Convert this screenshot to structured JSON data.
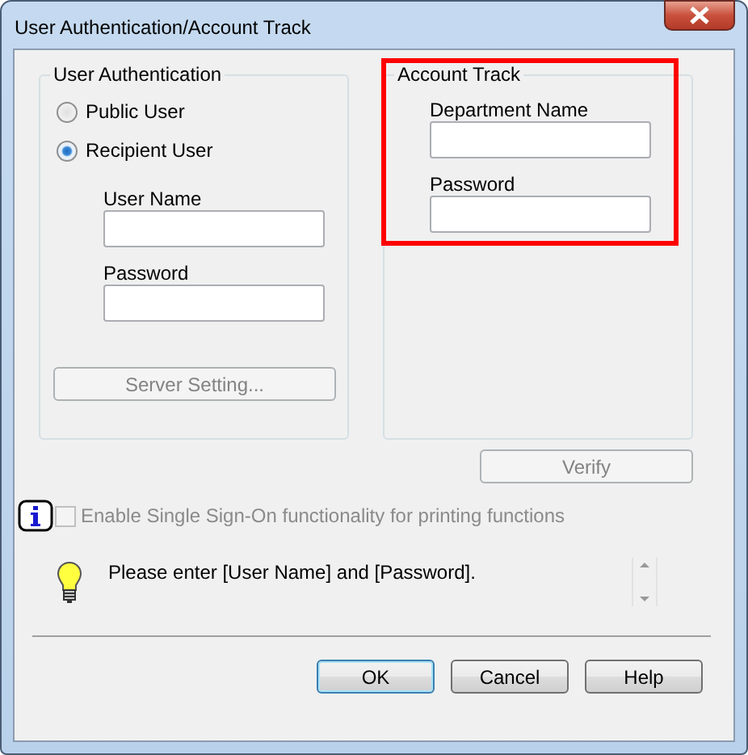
{
  "window": {
    "title": "User Authentication/Account Track"
  },
  "user_authentication": {
    "title": "User Authentication",
    "options": [
      {
        "label": "Public User",
        "selected": false
      },
      {
        "label": "Recipient User",
        "selected": true
      }
    ],
    "fields": [
      {
        "label": "User Name"
      },
      {
        "label": "Password"
      }
    ],
    "server_button": {
      "label": "Server Setting...",
      "disabled": true
    }
  },
  "account_track": {
    "title": "Account Track",
    "highlighted": true,
    "fields": [
      {
        "label": "Department Name"
      },
      {
        "label": "Password"
      }
    ]
  },
  "verify_button": {
    "label": "Verify",
    "disabled": true
  },
  "sso": {
    "label": "Enable Single Sign-On functionality for printing functions",
    "checked": false,
    "disabled": true
  },
  "message": "Please enter [User Name] and [Password].",
  "buttons": [
    {
      "label": "OK",
      "default": true
    },
    {
      "label": "Cancel",
      "default": false
    },
    {
      "label": "Help",
      "default": false
    }
  ]
}
